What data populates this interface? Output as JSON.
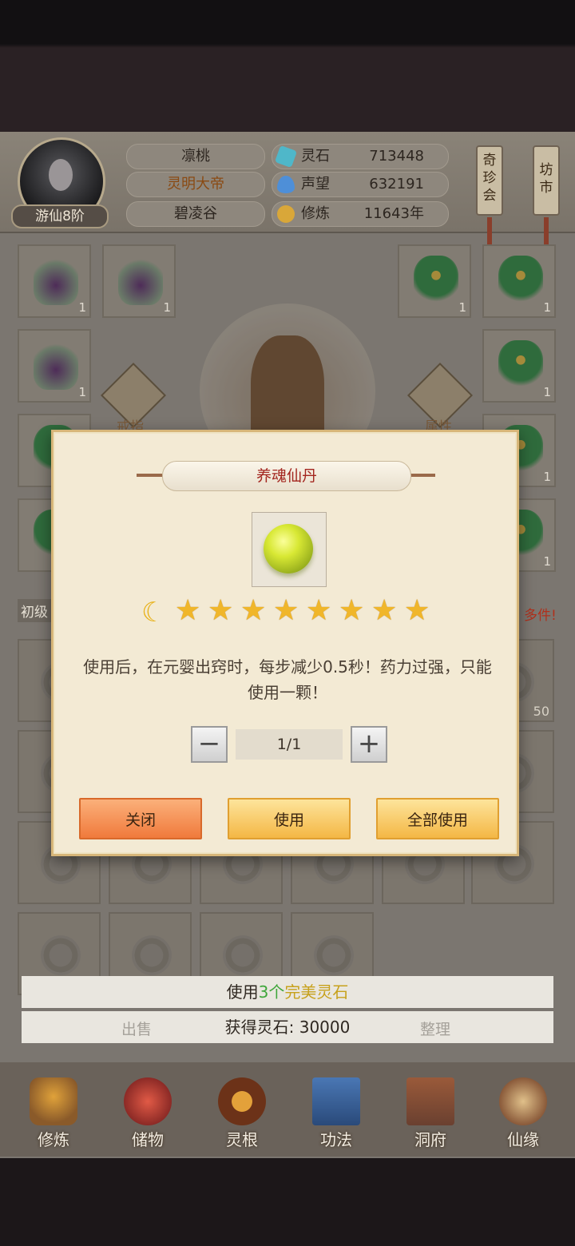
{
  "player": {
    "rank": "游仙8阶",
    "name": "凛桃",
    "title": "灵明大帝",
    "location": "碧凌谷"
  },
  "stats": [
    {
      "label": "灵石",
      "value": "713448",
      "icon": "spirit-stone-icon",
      "color": "#4fb7c9"
    },
    {
      "label": "声望",
      "value": "632191",
      "icon": "prestige-icon",
      "color": "#4e8fd8"
    },
    {
      "label": "修炼",
      "value": "11643年",
      "icon": "cultivation-icon",
      "color": "#d9a739"
    }
  ],
  "side_buttons": {
    "treasure": "奇珍会",
    "market": "坊市"
  },
  "equipment_slots": {
    "left_label": "戒指",
    "right_label": "属性",
    "left_counts": [
      "1",
      "1",
      "1"
    ],
    "right_counts": [
      "1",
      "1",
      "1",
      "1",
      "1"
    ],
    "tier_tag": "初级",
    "more_tag": "多件!",
    "bag_count": "50"
  },
  "info": {
    "line1_prefix": "使用",
    "line1_count": "3个",
    "line1_item": "完美灵石",
    "line2": "获得灵石: 30000",
    "sell": "出售",
    "organize": "整理"
  },
  "nav": [
    {
      "label": "修炼",
      "icon": "cultivate-icon"
    },
    {
      "label": "储物",
      "icon": "storage-bag-icon"
    },
    {
      "label": "灵根",
      "icon": "spirit-root-icon"
    },
    {
      "label": "功法",
      "icon": "technique-book-icon"
    },
    {
      "label": "洞府",
      "icon": "cave-house-icon"
    },
    {
      "label": "仙缘",
      "icon": "fortune-icon"
    }
  ],
  "modal": {
    "title": "养魂仙丹",
    "item_icon": "green-pill-orb-icon",
    "rating": {
      "moons": 1,
      "stars": 8
    },
    "description": "使用后，在元婴出窍时，每步减少0.5秒！药力过强，只能使用一颗！",
    "quantity": "1/1",
    "buttons": {
      "close": "关闭",
      "use": "使用",
      "use_all": "全部使用"
    }
  }
}
